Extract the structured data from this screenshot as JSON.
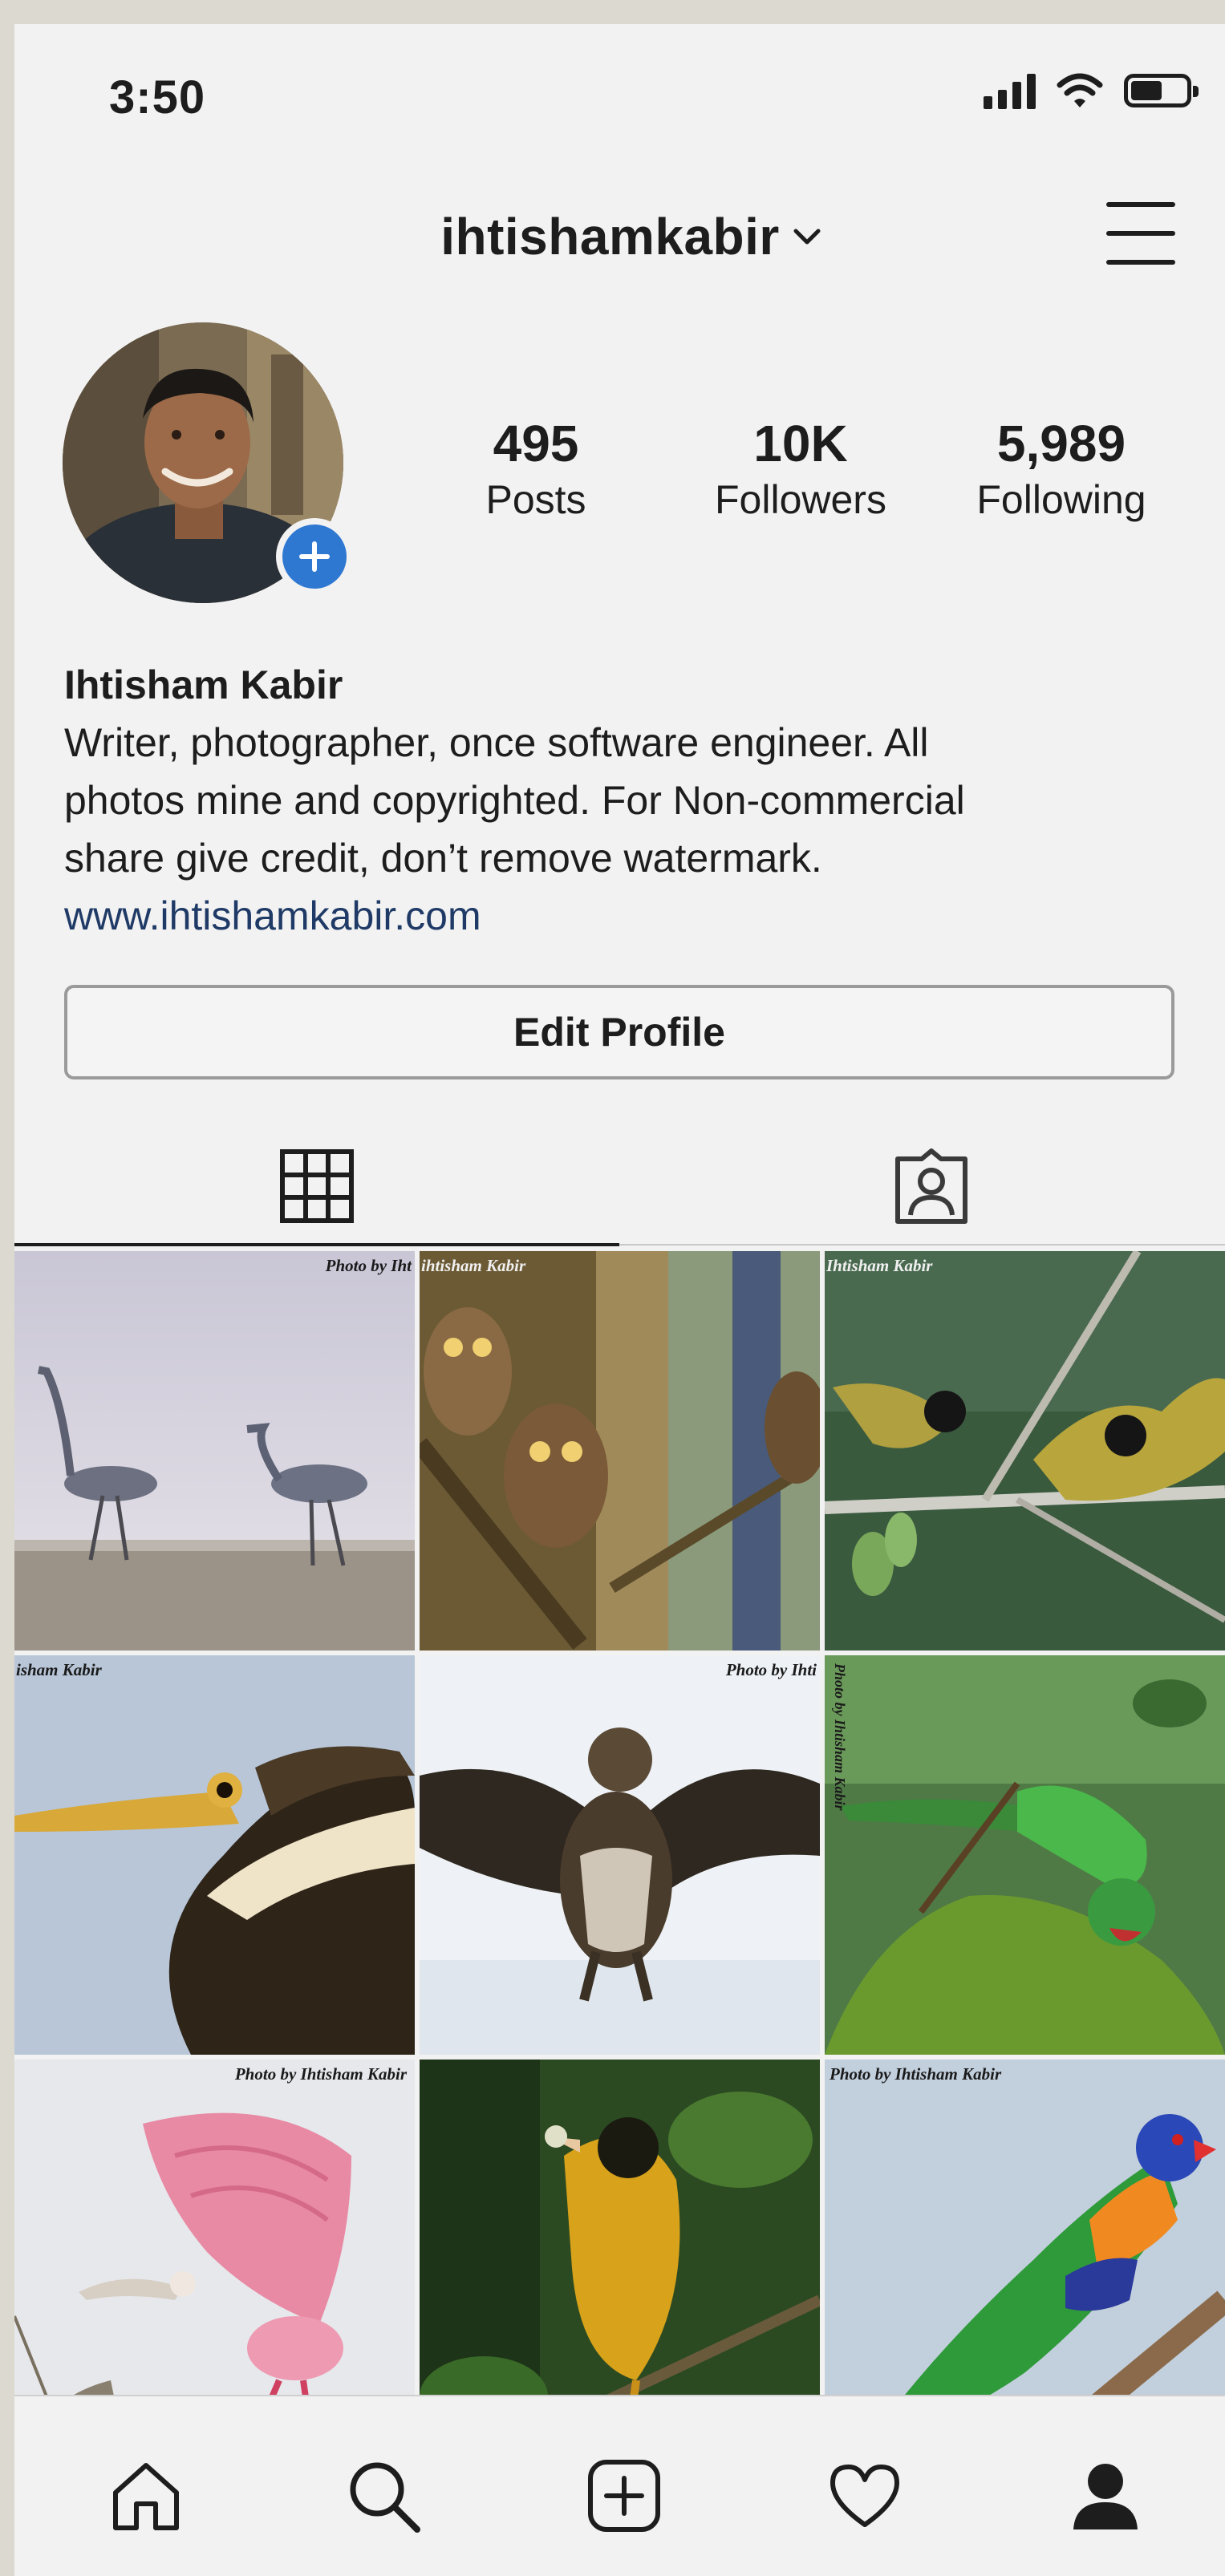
{
  "status_bar": {
    "time": "3:50"
  },
  "header": {
    "username": "ihtishamkabir"
  },
  "stats": [
    {
      "value": "495",
      "label": "Posts"
    },
    {
      "value": "10K",
      "label": "Followers"
    },
    {
      "value": "5,989",
      "label": "Following"
    }
  ],
  "bio": {
    "name": "Ihtisham Kabir",
    "lines": [
      "Writer, photographer, once software engineer. All",
      "photos mine and copyrighted. For Non-commercial",
      "share give credit, don’t remove watermark."
    ],
    "link": "www.ihtishamkabir.com"
  },
  "edit_profile_label": "Edit Profile",
  "posts": [
    {
      "subject": "grey herons",
      "credit": "Photo by Iht"
    },
    {
      "subject": "spotted owlets",
      "credit": "ihtisham Kabir"
    },
    {
      "subject": "black-crested bulbuls",
      "credit": "Ihtisham Kabir"
    },
    {
      "subject": "darter",
      "credit": "isham Kabir"
    },
    {
      "subject": "eagle",
      "credit": "Photo by Ihti"
    },
    {
      "subject": "parakeet",
      "credit": "Photo by Ihtisham Kabir"
    },
    {
      "subject": "spoonbill",
      "credit": "Photo by Ihtisham Kabir"
    },
    {
      "subject": "oriole",
      "credit": ""
    },
    {
      "subject": "rainbow lorikeet",
      "credit": "Photo by Ihtisham Kabir"
    }
  ],
  "colors": {
    "background": "#f2f2f2",
    "accent_blue": "#2f78d2",
    "link": "#1f3a66",
    "text": "#1d1d1d"
  },
  "icons": {
    "tabs": [
      "grid-icon",
      "tagged-person-icon"
    ],
    "nav": [
      "home-icon",
      "search-icon",
      "new-post-icon",
      "heart-icon",
      "profile-icon"
    ]
  }
}
